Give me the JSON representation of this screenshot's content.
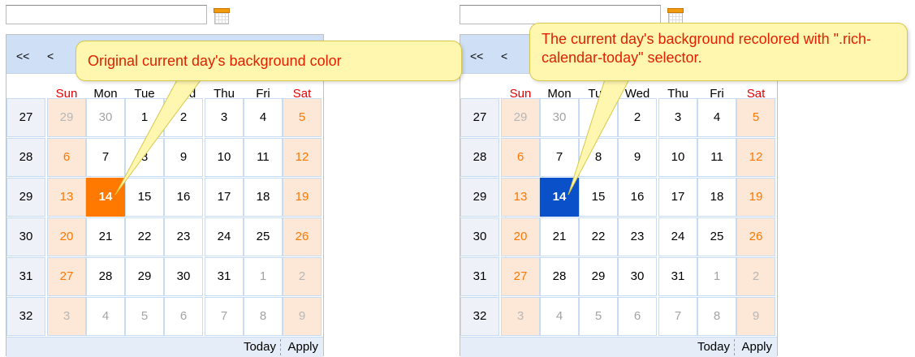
{
  "calendar": {
    "nav_prev_year": "<<",
    "nav_prev_month": "<",
    "weekdays": [
      "Sun",
      "Mon",
      "Tue",
      "Wed",
      "Thu",
      "Fri",
      "Sat"
    ],
    "weekdays_visible": [
      "Sun",
      "Mon",
      "Tue",
      "Wed",
      "Thu",
      "Fri",
      "Sat"
    ],
    "weeks": [
      {
        "num": "27",
        "days": [
          "29",
          "30",
          "1",
          "2",
          "3",
          "4",
          "5"
        ]
      },
      {
        "num": "28",
        "days": [
          "6",
          "7",
          "8",
          "9",
          "10",
          "11",
          "12"
        ]
      },
      {
        "num": "29",
        "days": [
          "13",
          "14",
          "15",
          "16",
          "17",
          "18",
          "19"
        ]
      },
      {
        "num": "30",
        "days": [
          "20",
          "21",
          "22",
          "23",
          "24",
          "25",
          "26"
        ]
      },
      {
        "num": "31",
        "days": [
          "27",
          "28",
          "29",
          "30",
          "31",
          "1",
          "2"
        ]
      },
      {
        "num": "32",
        "days": [
          "3",
          "4",
          "5",
          "6",
          "7",
          "8",
          "9"
        ]
      }
    ],
    "footer": {
      "today": "Today",
      "apply": "Apply"
    }
  },
  "left": {
    "callout": "Original current day's background  color",
    "today_color": "#ff7800"
  },
  "right": {
    "callout": "The current day's background recolored with \".rich-calendar-today\"  selector.",
    "today_color": "#0a50c8"
  },
  "colors": {
    "header_bg": "#cfe0f6",
    "weekend_bg": "#fde7d6",
    "weekend_text": "#ff7800",
    "callout_bg": "#fff7b0",
    "callout_text": "#e02000"
  }
}
